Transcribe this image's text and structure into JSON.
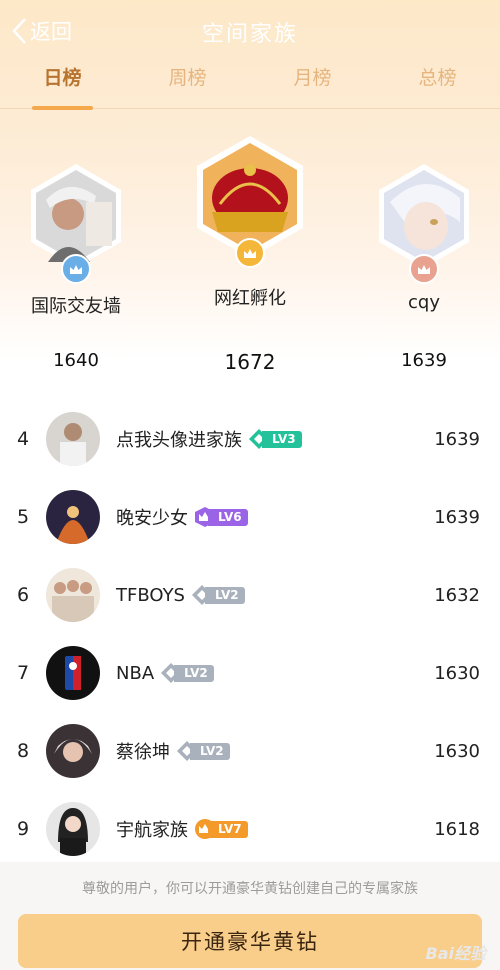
{
  "topbar": {
    "back_label": "返回",
    "title": "空间家族"
  },
  "tabs": [
    {
      "label": "日榜",
      "active": true
    },
    {
      "label": "周榜",
      "active": false
    },
    {
      "label": "月榜",
      "active": false
    },
    {
      "label": "总榜",
      "active": false
    }
  ],
  "podium": [
    {
      "name": "国际交友墙",
      "score": "1640",
      "badge_color": "#6aaee8",
      "icon": "crown-icon"
    },
    {
      "name": "网红孵化",
      "score": "1672",
      "badge_color": "#f5b73a",
      "icon": "crown-icon"
    },
    {
      "name": "cqy",
      "score": "1639",
      "badge_color": "#e8a28f",
      "icon": "crown-icon"
    }
  ],
  "ranking": [
    {
      "rank": "4",
      "name": "点我头像进家族",
      "level": "LV3",
      "level_color": "#23c29a",
      "score": "1639"
    },
    {
      "rank": "5",
      "name": "晚安少女",
      "level": "LV6",
      "level_color": "#9b64e6",
      "score": "1639"
    },
    {
      "rank": "6",
      "name": "TFBOYS",
      "level": "LV2",
      "level_color": "#a9b2bc",
      "score": "1632"
    },
    {
      "rank": "7",
      "name": "NBA",
      "level": "LV2",
      "level_color": "#a9b2bc",
      "score": "1630"
    },
    {
      "rank": "8",
      "name": "蔡徐坤",
      "level": "LV2",
      "level_color": "#a9b2bc",
      "score": "1630"
    },
    {
      "rank": "9",
      "name": "宇航家族",
      "level": "LV7",
      "level_color": "#f39a2a",
      "score": "1618"
    }
  ],
  "footer": {
    "notice": "尊敬的用户，你可以开通豪华黄钻创建自己的专属家族",
    "cta_label": "开通豪华黄钻",
    "watermark": "Bai经验"
  },
  "colors": {
    "accent": "#f5a84c",
    "cta": "#f9cd8a"
  }
}
